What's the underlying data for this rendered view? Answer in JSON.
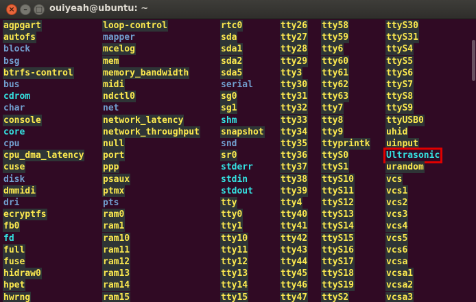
{
  "window": {
    "title": "ouiyeah@ubuntu: ~",
    "close_glyph": "×",
    "min_glyph": "–",
    "max_glyph": "□"
  },
  "colors": {
    "directory": "#729fcf",
    "device": "#fce94f",
    "device_bg": "#2e3436",
    "symlink": "#34e2e2",
    "highlight": "#e00000",
    "background": "#300a24"
  },
  "columns": [
    [
      {
        "text": "agpgart",
        "kind": "dev"
      },
      {
        "text": "autofs",
        "kind": "dev"
      },
      {
        "text": "block",
        "kind": "dir"
      },
      {
        "text": "bsg",
        "kind": "dir"
      },
      {
        "text": "btrfs-control",
        "kind": "dev"
      },
      {
        "text": "bus",
        "kind": "dir"
      },
      {
        "text": "cdrom",
        "kind": "lnk"
      },
      {
        "text": "char",
        "kind": "dir"
      },
      {
        "text": "console",
        "kind": "dev"
      },
      {
        "text": "core",
        "kind": "lnk"
      },
      {
        "text": "cpu",
        "kind": "dir"
      },
      {
        "text": "cpu_dma_latency",
        "kind": "dev"
      },
      {
        "text": "cuse",
        "kind": "dev"
      },
      {
        "text": "disk",
        "kind": "dir"
      },
      {
        "text": "dmmidi",
        "kind": "dev"
      },
      {
        "text": "dri",
        "kind": "dir"
      },
      {
        "text": "ecryptfs",
        "kind": "dev"
      },
      {
        "text": "fb0",
        "kind": "dev"
      },
      {
        "text": "fd",
        "kind": "lnk"
      },
      {
        "text": "full",
        "kind": "dev"
      },
      {
        "text": "fuse",
        "kind": "dev"
      },
      {
        "text": "hidraw0",
        "kind": "dev"
      },
      {
        "text": "hpet",
        "kind": "dev"
      },
      {
        "text": "hwrng",
        "kind": "dev"
      }
    ],
    [
      {
        "text": "loop-control",
        "kind": "dev"
      },
      {
        "text": "mapper",
        "kind": "dir"
      },
      {
        "text": "mcelog",
        "kind": "dev"
      },
      {
        "text": "mem",
        "kind": "dev"
      },
      {
        "text": "memory_bandwidth",
        "kind": "dev"
      },
      {
        "text": "midi",
        "kind": "dev"
      },
      {
        "text": "ndctl0",
        "kind": "dev"
      },
      {
        "text": "net",
        "kind": "dir"
      },
      {
        "text": "network_latency",
        "kind": "dev"
      },
      {
        "text": "network_throughput",
        "kind": "dev"
      },
      {
        "text": "null",
        "kind": "dev"
      },
      {
        "text": "port",
        "kind": "dev"
      },
      {
        "text": "ppp",
        "kind": "dev"
      },
      {
        "text": "psaux",
        "kind": "dev"
      },
      {
        "text": "ptmx",
        "kind": "dev"
      },
      {
        "text": "pts",
        "kind": "dir"
      },
      {
        "text": "ram0",
        "kind": "dev"
      },
      {
        "text": "ram1",
        "kind": "dev"
      },
      {
        "text": "ram10",
        "kind": "dev"
      },
      {
        "text": "ram11",
        "kind": "dev"
      },
      {
        "text": "ram12",
        "kind": "dev"
      },
      {
        "text": "ram13",
        "kind": "dev"
      },
      {
        "text": "ram14",
        "kind": "dev"
      },
      {
        "text": "ram15",
        "kind": "dev"
      }
    ],
    [
      {
        "text": "rtc0",
        "kind": "dev"
      },
      {
        "text": "sda",
        "kind": "dev"
      },
      {
        "text": "sda1",
        "kind": "dev"
      },
      {
        "text": "sda2",
        "kind": "dev"
      },
      {
        "text": "sda5",
        "kind": "dev"
      },
      {
        "text": "serial",
        "kind": "dir"
      },
      {
        "text": "sg0",
        "kind": "dev"
      },
      {
        "text": "sg1",
        "kind": "dev"
      },
      {
        "text": "shm",
        "kind": "lnk"
      },
      {
        "text": "snapshot",
        "kind": "dev"
      },
      {
        "text": "snd",
        "kind": "dir"
      },
      {
        "text": "sr0",
        "kind": "dev"
      },
      {
        "text": "stderr",
        "kind": "lnk"
      },
      {
        "text": "stdin",
        "kind": "lnk"
      },
      {
        "text": "stdout",
        "kind": "lnk"
      },
      {
        "text": "tty",
        "kind": "dev"
      },
      {
        "text": "tty0",
        "kind": "dev"
      },
      {
        "text": "tty1",
        "kind": "dev"
      },
      {
        "text": "tty10",
        "kind": "dev"
      },
      {
        "text": "tty11",
        "kind": "dev"
      },
      {
        "text": "tty12",
        "kind": "dev"
      },
      {
        "text": "tty13",
        "kind": "dev"
      },
      {
        "text": "tty14",
        "kind": "dev"
      },
      {
        "text": "tty15",
        "kind": "dev"
      }
    ],
    [
      {
        "text": "tty26",
        "kind": "dev"
      },
      {
        "text": "tty27",
        "kind": "dev"
      },
      {
        "text": "tty28",
        "kind": "dev"
      },
      {
        "text": "tty29",
        "kind": "dev"
      },
      {
        "text": "tty3",
        "kind": "dev"
      },
      {
        "text": "tty30",
        "kind": "dev"
      },
      {
        "text": "tty31",
        "kind": "dev"
      },
      {
        "text": "tty32",
        "kind": "dev"
      },
      {
        "text": "tty33",
        "kind": "dev"
      },
      {
        "text": "tty34",
        "kind": "dev"
      },
      {
        "text": "tty35",
        "kind": "dev"
      },
      {
        "text": "tty36",
        "kind": "dev"
      },
      {
        "text": "tty37",
        "kind": "dev"
      },
      {
        "text": "tty38",
        "kind": "dev"
      },
      {
        "text": "tty39",
        "kind": "dev"
      },
      {
        "text": "tty4",
        "kind": "dev"
      },
      {
        "text": "tty40",
        "kind": "dev"
      },
      {
        "text": "tty41",
        "kind": "dev"
      },
      {
        "text": "tty42",
        "kind": "dev"
      },
      {
        "text": "tty43",
        "kind": "dev"
      },
      {
        "text": "tty44",
        "kind": "dev"
      },
      {
        "text": "tty45",
        "kind": "dev"
      },
      {
        "text": "tty46",
        "kind": "dev"
      },
      {
        "text": "tty47",
        "kind": "dev"
      }
    ],
    [
      {
        "text": "tty58",
        "kind": "dev"
      },
      {
        "text": "tty59",
        "kind": "dev"
      },
      {
        "text": "tty6",
        "kind": "dev"
      },
      {
        "text": "tty60",
        "kind": "dev"
      },
      {
        "text": "tty61",
        "kind": "dev"
      },
      {
        "text": "tty62",
        "kind": "dev"
      },
      {
        "text": "tty63",
        "kind": "dev"
      },
      {
        "text": "tty7",
        "kind": "dev"
      },
      {
        "text": "tty8",
        "kind": "dev"
      },
      {
        "text": "tty9",
        "kind": "dev"
      },
      {
        "text": "ttyprintk",
        "kind": "dev"
      },
      {
        "text": "ttyS0",
        "kind": "dev"
      },
      {
        "text": "ttyS1",
        "kind": "dev"
      },
      {
        "text": "ttyS10",
        "kind": "dev"
      },
      {
        "text": "ttyS11",
        "kind": "dev"
      },
      {
        "text": "ttyS12",
        "kind": "dev"
      },
      {
        "text": "ttyS13",
        "kind": "dev"
      },
      {
        "text": "ttyS14",
        "kind": "dev"
      },
      {
        "text": "ttyS15",
        "kind": "dev"
      },
      {
        "text": "ttyS16",
        "kind": "dev"
      },
      {
        "text": "ttyS17",
        "kind": "dev"
      },
      {
        "text": "ttyS18",
        "kind": "dev"
      },
      {
        "text": "ttyS19",
        "kind": "dev"
      },
      {
        "text": "ttyS2",
        "kind": "dev"
      }
    ],
    [
      {
        "text": "ttyS30",
        "kind": "dev"
      },
      {
        "text": "ttyS31",
        "kind": "dev"
      },
      {
        "text": "ttyS4",
        "kind": "dev"
      },
      {
        "text": "ttyS5",
        "kind": "dev"
      },
      {
        "text": "ttyS6",
        "kind": "dev"
      },
      {
        "text": "ttyS7",
        "kind": "dev"
      },
      {
        "text": "ttyS8",
        "kind": "dev"
      },
      {
        "text": "ttyS9",
        "kind": "dev"
      },
      {
        "text": "ttyUSB0",
        "kind": "dev"
      },
      {
        "text": "uhid",
        "kind": "dev"
      },
      {
        "text": "uinput",
        "kind": "dev"
      },
      {
        "text": "Ultrasonic",
        "kind": "lnk",
        "highlight": true
      },
      {
        "text": "urandom",
        "kind": "dev"
      },
      {
        "text": "vcs",
        "kind": "dev"
      },
      {
        "text": "vcs1",
        "kind": "dev"
      },
      {
        "text": "vcs2",
        "kind": "dev"
      },
      {
        "text": "vcs3",
        "kind": "dev"
      },
      {
        "text": "vcs4",
        "kind": "dev"
      },
      {
        "text": "vcs5",
        "kind": "dev"
      },
      {
        "text": "vcs6",
        "kind": "dev"
      },
      {
        "text": "vcsa",
        "kind": "dev"
      },
      {
        "text": "vcsa1",
        "kind": "dev"
      },
      {
        "text": "vcsa2",
        "kind": "dev"
      },
      {
        "text": "vcsa3",
        "kind": "dev"
      }
    ]
  ]
}
